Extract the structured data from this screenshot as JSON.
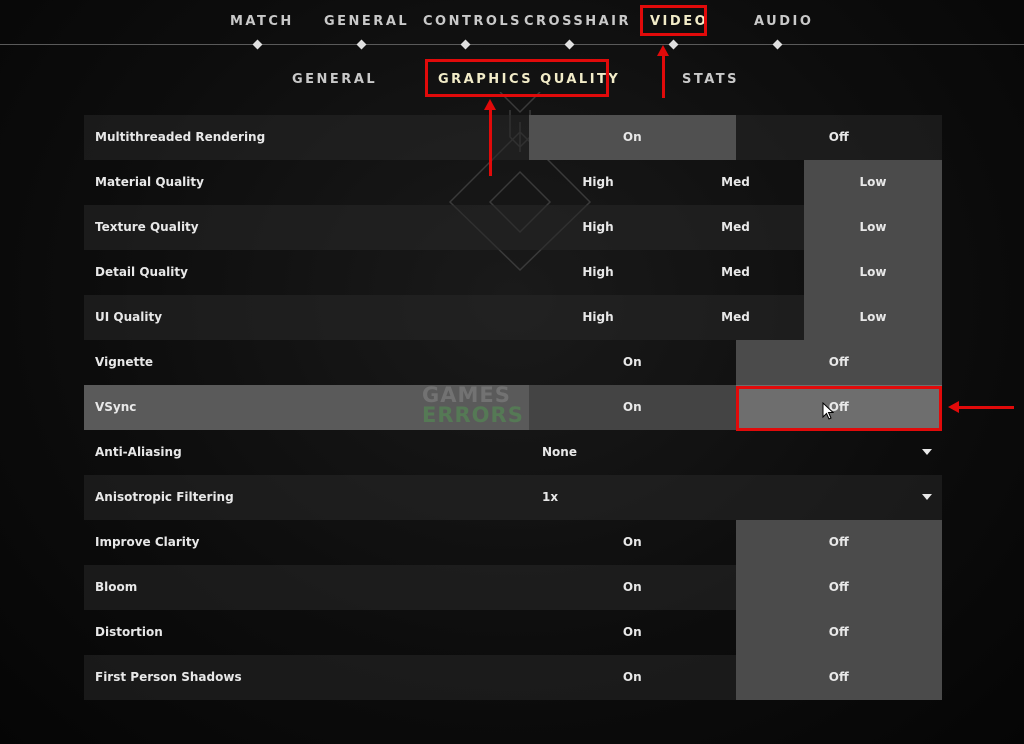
{
  "top_tabs": [
    {
      "label": "MATCH",
      "active": false
    },
    {
      "label": "GENERAL",
      "active": false
    },
    {
      "label": "CONTROLS",
      "active": false
    },
    {
      "label": "CROSSHAIR",
      "active": false
    },
    {
      "label": "VIDEO",
      "active": true
    },
    {
      "label": "AUDIO",
      "active": false
    }
  ],
  "sub_tabs": [
    {
      "label": "GENERAL",
      "active": false
    },
    {
      "label": "GRAPHICS QUALITY",
      "active": true
    },
    {
      "label": "STATS",
      "active": false
    }
  ],
  "settings": [
    {
      "label": "Multithreaded Rendering",
      "options": [
        "On",
        "Off"
      ],
      "selected": "On"
    },
    {
      "label": "Material Quality",
      "options": [
        "High",
        "Med",
        "Low"
      ],
      "selected": "Low"
    },
    {
      "label": "Texture Quality",
      "options": [
        "High",
        "Med",
        "Low"
      ],
      "selected": "Low"
    },
    {
      "label": "Detail Quality",
      "options": [
        "High",
        "Med",
        "Low"
      ],
      "selected": "Low"
    },
    {
      "label": "UI Quality",
      "options": [
        "High",
        "Med",
        "Low"
      ],
      "selected": "Low"
    },
    {
      "label": "Vignette",
      "options": [
        "On",
        "Off"
      ],
      "selected": "Off"
    },
    {
      "label": "VSync",
      "options": [
        "On",
        "Off"
      ],
      "selected": "Off"
    },
    {
      "label": "Anti-Aliasing",
      "dropdown": "None"
    },
    {
      "label": "Anisotropic Filtering",
      "dropdown": "1x"
    },
    {
      "label": "Improve Clarity",
      "options": [
        "On",
        "Off"
      ],
      "selected": "Off"
    },
    {
      "label": "Bloom",
      "options": [
        "On",
        "Off"
      ],
      "selected": "Off"
    },
    {
      "label": "Distortion",
      "options": [
        "On",
        "Off"
      ],
      "selected": "Off"
    },
    {
      "label": "First Person Shadows",
      "options": [
        "On",
        "Off"
      ],
      "selected": "Off"
    }
  ],
  "watermark": {
    "line1": "GAMES",
    "line2": "ERRORS"
  },
  "colors": {
    "annotation_red": "#e10a0a",
    "active_tab": "#f2ecc8",
    "selected_option": "#4b4b4b"
  },
  "icons": {
    "dropdown": "caret-down-icon",
    "cursor": "mouse-pointer-icon",
    "nav_marker": "diamond-icon"
  }
}
